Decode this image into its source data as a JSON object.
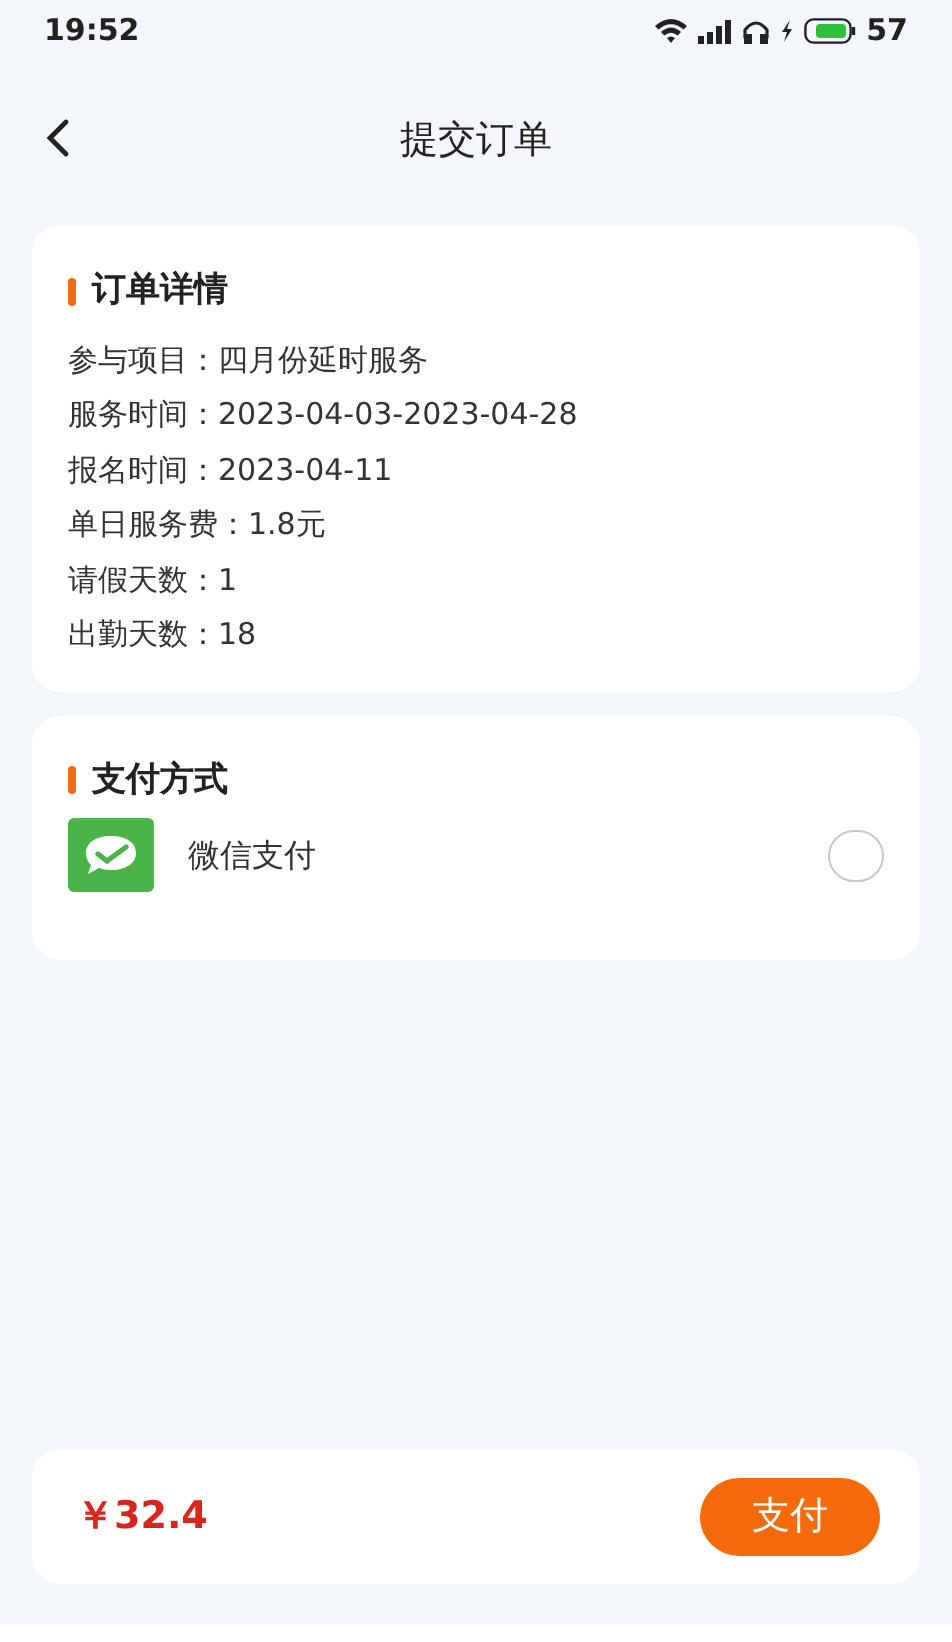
{
  "status_bar": {
    "time": "19:52",
    "battery": "57"
  },
  "header": {
    "title": "提交订单"
  },
  "order_details": {
    "title": "订单详情",
    "rows": [
      "参与项目：四月份延时服务",
      "服务时间：2023-04-03-2023-04-28",
      "报名时间：2023-04-11",
      "单日服务费：1.8元",
      "请假天数：1",
      "出勤天数：18"
    ]
  },
  "payment": {
    "title": "支付方式",
    "options": [
      {
        "label": "微信支付",
        "selected": false
      }
    ]
  },
  "footer": {
    "total": "￥32.4",
    "pay_button": "支付"
  }
}
